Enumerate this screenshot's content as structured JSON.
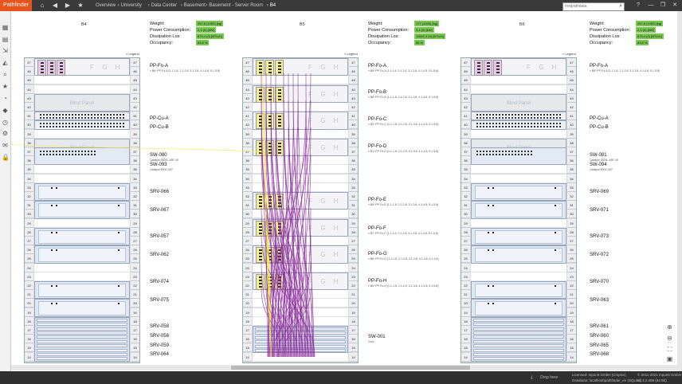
{
  "app": {
    "name": "Pathfinder"
  },
  "nav": {
    "home_icon": "home-icon",
    "back_icon": "arrow-left-icon",
    "forward_icon": "arrow-right-icon",
    "favorite_icon": "star-icon",
    "breadcrumb": [
      "Overview",
      "University",
      "Data Center",
      "Basement",
      "Basement - Server Room",
      "B4"
    ],
    "search_placeholder": "Instpathdata",
    "window": {
      "help": "?",
      "minimize": "—",
      "restore": "❐",
      "close": "✕"
    }
  },
  "toolbar": {
    "icons": [
      "dashboard-icon",
      "layout-icon",
      "import-icon",
      "export-icon",
      "search-icon",
      "favorite-icon",
      "report-icon",
      "tag-icon",
      "history-icon",
      "tree-icon",
      "mail-icon",
      "lock-icon"
    ]
  },
  "racks": [
    {
      "name": "B4",
      "stats": [
        {
          "label": "Weight:",
          "value": "267,8 (1000) [kg]"
        },
        {
          "label": "Power Consumption:",
          "value": "2,1 (0) [kW]"
        },
        {
          "label": "Dissipation Los:",
          "value": "879,4 (0) [BTU/h]"
        },
        {
          "label": "Occupancy:",
          "value": "63,6 %"
        }
      ],
      "legend": "» Legend",
      "devices": [
        {
          "label": "PP-Fo-A",
          "sub": "» B6~PP-Fo-A (1.1-1.8, 2.1-2.8, 3.1-3.8, 4.1-4.8, 5.1-5.8)"
        },
        {
          "label": "Blind Panel"
        },
        {
          "label": "PP-Cu-A"
        },
        {
          "label": "PP-Cu-B"
        },
        {
          "label": "Blind Panel"
        },
        {
          "label": "SW-080",
          "sub": "Catalyst 9300L-48P-4X"
        },
        {
          "label": "SW-093",
          "sub": "Catalyst 9000-24P"
        },
        {
          "label": "SRV-066"
        },
        {
          "label": "SRV-067"
        },
        {
          "label": "SRV-057"
        },
        {
          "label": "SRV-062"
        },
        {
          "label": "SRV-074"
        },
        {
          "label": "SRV-075"
        },
        {
          "label": "SRV-058"
        },
        {
          "label": "SRV-056"
        },
        {
          "label": "SRV-059"
        },
        {
          "label": "SRV-064"
        }
      ]
    },
    {
      "name": "B5",
      "stats": [
        {
          "label": "Weight:",
          "value": "177 (1000) [kg]"
        },
        {
          "label": "Power Consumption:",
          "value": "3,4 (0) [kW]"
        },
        {
          "label": "Dissipation Los:",
          "value": "11662,3 (0) [BTU/h]"
        },
        {
          "label": "Occupancy:",
          "value": "66 %"
        }
      ],
      "legend": "» Legend",
      "devices": [
        {
          "label": "PP-Fo-A",
          "sub": "» B6~PP-Fo-A (1.1-1.8, 2.1-2.8, 3.1-3.8, 4.1-4.8, 5.1-5.8)"
        },
        {
          "label": "PP-Fo-B",
          "sub": "» B6~PP-Fo-B (1.1-1.8, 2.1-2.8, 3.1-3.8, 4.1-4.8, 5.1-5.8)"
        },
        {
          "label": "PP-Fo-C",
          "sub": "» B3~PP-Fo-C (1.1-1.8, 2.1-2.8, 3.1-3.8, 4.1-4.8, 5.1-5.8)"
        },
        {
          "label": "PP-Fo-D",
          "sub": "» B1~PP-Fo-D (1.1-1.8, 2.1-2.8, 3.1-3.8, 4.1-4.8, 5.1-5.8)"
        },
        {
          "label": "PP-Fo-E",
          "sub": "» B6~PP-Fo-E (1.1-1.8, 2.1-2.8, 3.1-3.8, 4.1-4.8, 5.1-5.8)"
        },
        {
          "label": "PP-Fo-F",
          "sub": "» B7~PP-Fo-F (1.1-1.8, 2.1-2.8, 3.1-3.8, 4.1-4.8, 5.1-5.8)"
        },
        {
          "label": "PP-Fo-G",
          "sub": "» B6~PP-Fo-G (1.1-1.8, 2.1-2.8, 3.1-3.8, 4.1-4.8, 5.1-5.8)"
        },
        {
          "label": "PP-Fo-H",
          "sub": "» B6~PP-Fo-H (1.1-1.8, 2.1-2.8, 3.1-3.8, 4.1-4.8, 5.1-5.8)"
        },
        {
          "label": "SW-001",
          "sub": "Core"
        }
      ]
    },
    {
      "name": "B6",
      "stats": [
        {
          "label": "Weight:",
          "value": "267,8 (1000) [kg]"
        },
        {
          "label": "Power Consumption:",
          "value": "2,1 (0) [kW]"
        },
        {
          "label": "Dissipation Los:",
          "value": "879,4 (0) [BTU/h]"
        },
        {
          "label": "Occupancy:",
          "value": "63,6 %"
        }
      ],
      "legend": "» Legend",
      "devices": [
        {
          "label": "PP-Fo-A",
          "sub": "» B5~PP-Fo-A (1.1-1.8, 2.1-2.8, 3.1-3.8, 4.1-4.8, 5.1-5.8)"
        },
        {
          "label": "Blind Panel"
        },
        {
          "label": "PP-Cu-A"
        },
        {
          "label": "PP-Cu-B"
        },
        {
          "label": "Blind Panel"
        },
        {
          "label": "SW-081",
          "sub": "Catalyst 9300L-48P-4X"
        },
        {
          "label": "SW-094",
          "sub": "Catalyst 9000-24P"
        },
        {
          "label": "SRV-069"
        },
        {
          "label": "SRV-071"
        },
        {
          "label": "SRV-073"
        },
        {
          "label": "SRV-072"
        },
        {
          "label": "SRV-070"
        },
        {
          "label": "SRV-063"
        },
        {
          "label": "SRV-061"
        },
        {
          "label": "SRV-060"
        },
        {
          "label": "SRV-065"
        },
        {
          "label": "SRV-068"
        }
      ]
    }
  ],
  "units": [
    "47",
    "46",
    "45",
    "44",
    "43",
    "42",
    "41",
    "40",
    "39",
    "38",
    "37",
    "36",
    "35",
    "34",
    "33",
    "32",
    "31",
    "30",
    "29",
    "28",
    "27",
    "26",
    "25",
    "24",
    "23",
    "22",
    "21",
    "20",
    "19",
    "18",
    "17",
    "16",
    "15",
    "14"
  ],
  "fgh": [
    "F",
    "G",
    "H"
  ],
  "zoom_icons": [
    "zoom-in-icon",
    "zoom-out-icon",
    "fit-icon",
    "export-image-icon"
  ],
  "footer": {
    "drop": "Drop here",
    "license": "Licensed: Inpuntt GmbH (Cmplxs)",
    "database": "Database: localhost\\pathfinder_en (SQLite)",
    "copyright": "© 2011-2021 Inpuntt GmbH",
    "version": "v3.3.2.498 (64 Bit)"
  },
  "colors": {
    "accent": "#e8541e",
    "stat_ok": "#78c850",
    "fiber_yellow": "#f2ee9a",
    "fiber_pink": "#eac8ea",
    "cable_purple": "#8a2a9a",
    "cable_yellow": "#f4e84a"
  }
}
